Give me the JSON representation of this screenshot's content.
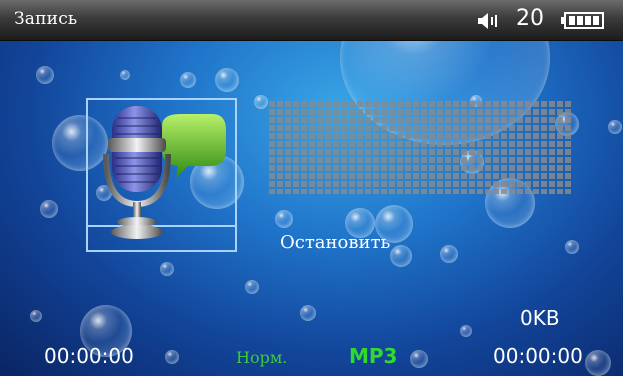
{
  "header": {
    "title": "Запись",
    "volume_icon": "speaker-icon",
    "volume": "20",
    "battery_icon": "battery-full-icon"
  },
  "main": {
    "record_icon": "microphone-chat-icon",
    "level_meter_icon": "level-meter-icon",
    "status": "Остановить",
    "file_size": "0KB"
  },
  "footer": {
    "elapsed_time": "00:00:00",
    "quality": "Норм.",
    "format": "MP3",
    "total_time": "00:00:00"
  },
  "colors": {
    "background": "#1f73c9",
    "title_bar": "#3b3b3b",
    "text": "#ffffff",
    "green_label": "#3ec83e",
    "frame": "#a9d3ff"
  }
}
